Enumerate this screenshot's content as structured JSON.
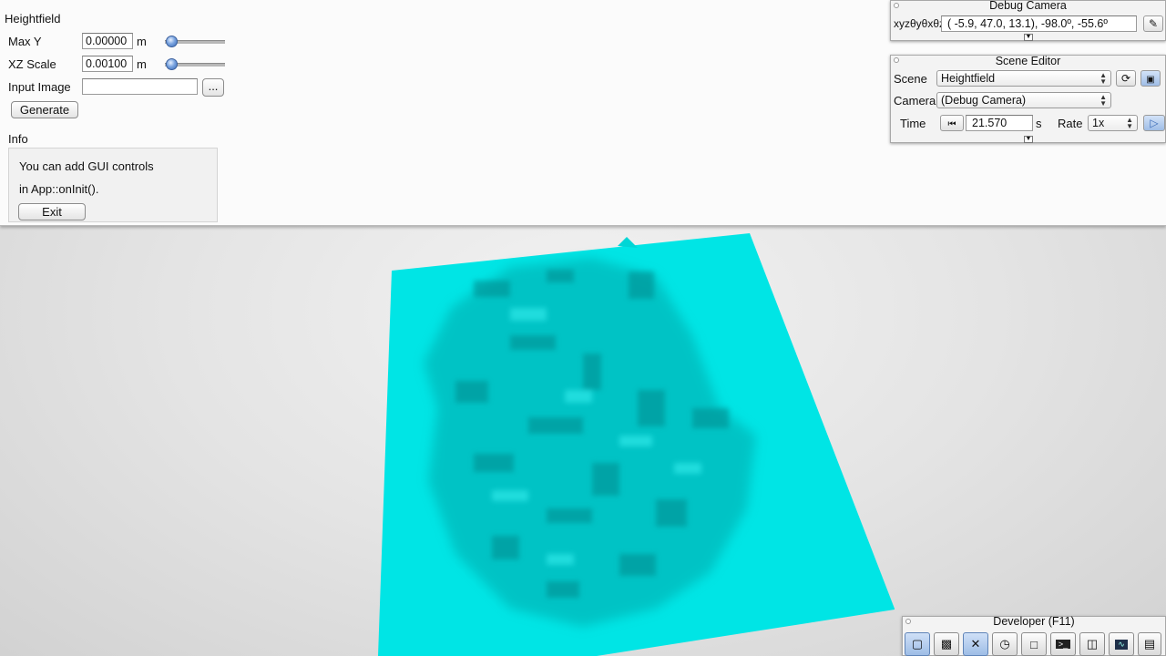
{
  "left_panel": {
    "title": "Heightfield",
    "max_y": {
      "label": "Max Y",
      "value": "0.00000",
      "unit": "m",
      "slider_fraction": 0.1
    },
    "xz_scale": {
      "label": "XZ Scale",
      "value": "0.00100",
      "unit": "m",
      "slider_fraction": 0.1
    },
    "input_image": {
      "label": "Input Image",
      "value": "",
      "browse_label": "..."
    },
    "generate_label": "Generate",
    "info": {
      "title": "Info",
      "line1": "You can add GUI controls",
      "line2": "in App::onInit().",
      "exit_label": "Exit"
    }
  },
  "debug_camera": {
    "title": "Debug Camera",
    "coord_label": "xyzθyθxθz",
    "coord_value": "( -5.9,  47.0,  13.1), -98.0º, -55.6º"
  },
  "scene_editor": {
    "title": "Scene Editor",
    "scene_label": "Scene",
    "scene_value": "Heightfield",
    "camera_label": "Camera",
    "camera_value": "(Debug Camera)",
    "time_label": "Time",
    "time_value": "21.570",
    "time_unit": "s",
    "rate_label": "Rate",
    "rate_value": "1x"
  },
  "developer": {
    "title": "Developer (F11)",
    "icons": [
      "camera-icon",
      "clapperboard-icon",
      "tools-icon",
      "clock-icon",
      "new-window-icon",
      "terminal-icon",
      "scene-graph-icon",
      "profiler-icon",
      "document-icon"
    ]
  },
  "colors": {
    "heightfield": "#00e5e5",
    "accent": "#3c6cb8"
  }
}
